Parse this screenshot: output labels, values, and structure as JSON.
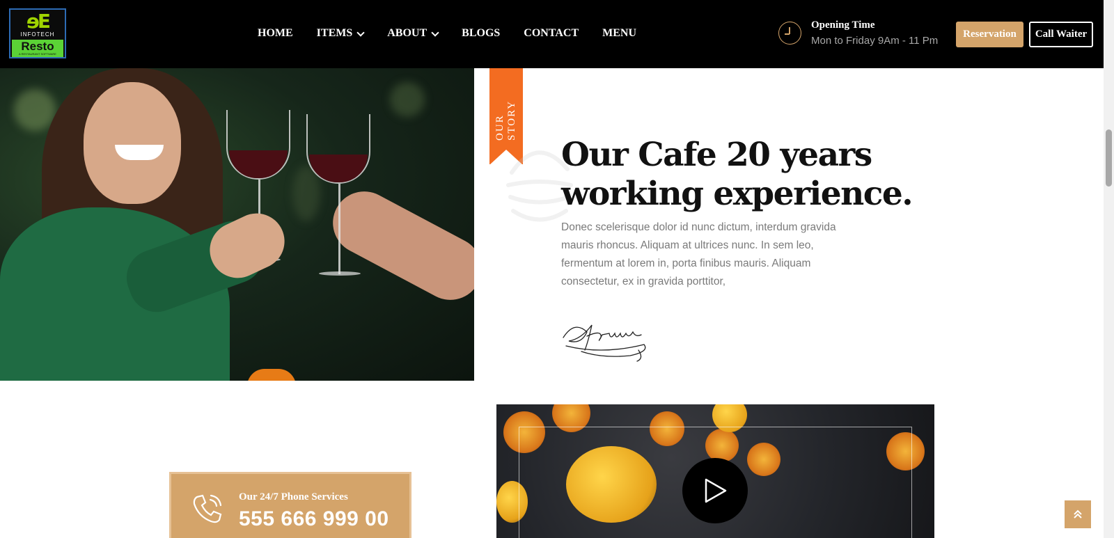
{
  "logo": {
    "mark": "ɘE",
    "sub": "INFOTECH",
    "name": "Resto",
    "tagline": "A RESTAURANT SOFTWARE"
  },
  "nav": {
    "items": [
      {
        "label": "HOME"
      },
      {
        "label": "ITEMS",
        "dropdown": true
      },
      {
        "label": "ABOUT",
        "dropdown": true
      },
      {
        "label": "BLOGS"
      },
      {
        "label": "CONTACT"
      },
      {
        "label": "MENU"
      }
    ]
  },
  "opening": {
    "title": "Opening Time",
    "hours": "Mon to Friday 9Am - 11 Pm",
    "icon": "clock-icon"
  },
  "buttons": {
    "reservation": "Reservation",
    "call_waiter": "Call Waiter"
  },
  "story": {
    "ribbon": "OUR STORY",
    "title_line1": "Our Cafe 20 years",
    "title_line2": "working experience.",
    "text": "Donec scelerisque dolor id nunc dictum, interdum gravida mauris rhoncus. Aliquam at ultrices nunc. In sem leo, fermentum at lorem in, porta finibus mauris. Aliquam consectetur, ex in gravida porttitor,"
  },
  "phone": {
    "label": "Our 24/7 Phone Services",
    "number": "555 666 999 00",
    "icon": "phone-icon"
  },
  "video": {
    "icon": "play-icon"
  },
  "colors": {
    "accent": "#d4a46a",
    "ribbon": "#f36c21",
    "header": "#000000"
  }
}
